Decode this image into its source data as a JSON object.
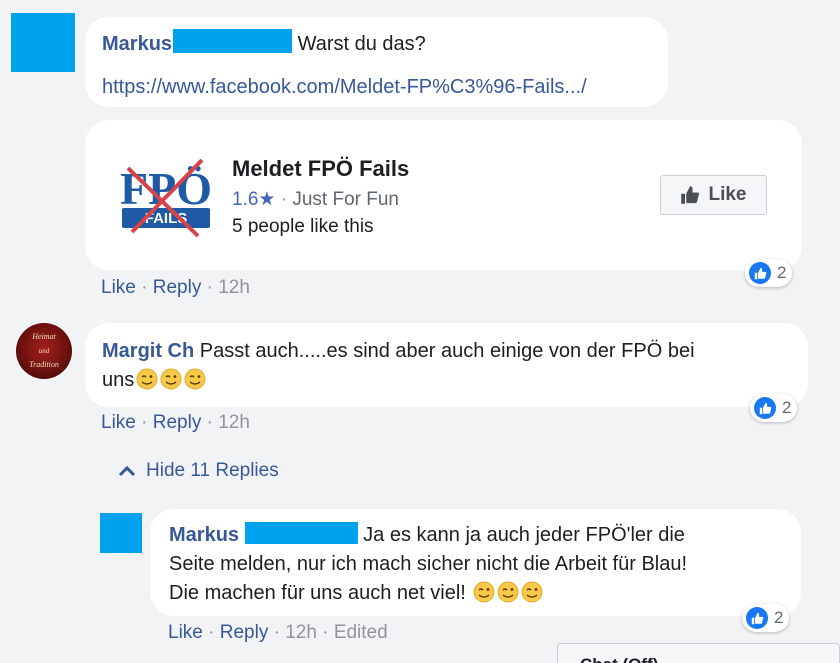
{
  "comments": [
    {
      "author": "Markus",
      "text": "Warst du das?",
      "link": "https://www.facebook.com/Meldet-FP%C3%96-Fails.../",
      "reaction_count": "2",
      "actions": {
        "like": "Like",
        "reply": "Reply",
        "time": "12h"
      }
    },
    {
      "author": "Margit Ch",
      "text_line1": "Passt auch.....es sind aber auch einige von der FPÖ bei",
      "text_line2": "uns",
      "reaction_count": "2",
      "actions": {
        "like": "Like",
        "reply": "Reply",
        "time": "12h"
      }
    }
  ],
  "page_card": {
    "title": "Meldet FPÖ Fails",
    "rating": "1.6",
    "category": "Just For Fun",
    "likes_text": "5 people like this",
    "like_button": "Like",
    "logo_text_top": "FPÖ",
    "logo_text_bottom": "FAILS"
  },
  "hide_replies": "Hide 11 Replies",
  "reply": {
    "author": "Markus",
    "text_line1": "Ja es kann ja auch jeder FPÖ'ler die",
    "text_line2": "Seite melden, nur ich mach sicher nicht die Arbeit für Blau!",
    "text_line3": "Die machen für uns auch net viel!",
    "reaction_count": "2",
    "actions": {
      "like": "Like",
      "reply": "Reply",
      "time": "12h",
      "edited": "Edited"
    }
  },
  "chat_bar": {
    "label": "Chat (Off)"
  },
  "colors": {
    "link": "#385898",
    "redaction": "#00a2ed",
    "like_blue": "#1877f2"
  }
}
